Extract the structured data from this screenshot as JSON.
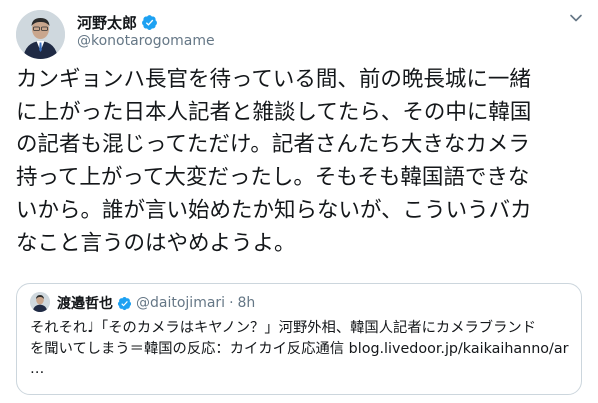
{
  "author": {
    "name": "河野太郎",
    "handle": "@konotarogomame"
  },
  "tweet": {
    "lines": [
      "カンギョンハ長官を待っている間、前の晩長城に一緒",
      "に上がった日本人記者と雑談してたら、その中に韓国",
      "の記者も混じってただけ。記者さんたち大きなカメラ",
      "持って上がって大変だったし。そもそも韓国語できな",
      "いから。誰が言い始めたか知らないが、こういうバカ",
      "なこと言うのはやめようよ。"
    ]
  },
  "quoted_tweet": {
    "name": "渡邉哲也",
    "handle": "@daitojimari",
    "separator": "·",
    "time": "8h",
    "lines": [
      "それそれ♩「そのカメラはキヤノン？」河野外相、韓国人記者にカメラブランド",
      "を聞いてしまう＝韓国の反応：カイカイ反応通信 blog.livedoor.jp/kaikaihanno/ar",
      "…"
    ]
  },
  "icons": {
    "verified": "verified-badge-icon",
    "menu": "chevron-down-icon"
  },
  "colors": {
    "verified_blue": "#1da1f2",
    "text": "#14171a",
    "secondary_text": "#657786",
    "border": "#ccd6dd"
  }
}
